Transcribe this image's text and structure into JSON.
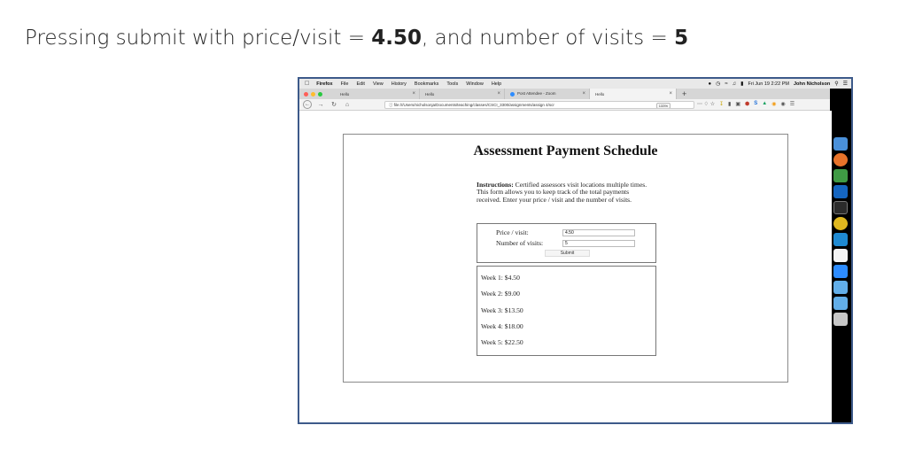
{
  "caption": {
    "lead": "Pressing submit with price/visit = ",
    "price": "4.50",
    "middle": ", and number of visits = ",
    "visits": "5"
  },
  "menubar": {
    "items": [
      "Firefox",
      "File",
      "Edit",
      "View",
      "History",
      "Bookmarks",
      "Tools",
      "Window",
      "Help"
    ],
    "datetime": "Fri Jun 19  2:22 PM",
    "user": "John Nicholson"
  },
  "tabs": [
    {
      "label": "Hello"
    },
    {
      "label": "Hello"
    },
    {
      "label": "Post Attendee - Zoom"
    },
    {
      "label": "Hello"
    }
  ],
  "toolbar": {
    "url": "file:///Users/nicholsonja/Documents/teaching/classes/CSCI_3300/assignments/assign 4/scr",
    "zoom": "133%"
  },
  "page": {
    "title": "Assessment Payment Schedule",
    "instructions_label": "Instructions:",
    "instructions_text": " Certified assessors visit locations multiple times. This form allows you to keep track of the total payments received. Enter your price / visit and the number of visits.",
    "form": {
      "price_label": "Price / visit:",
      "price_value": "4.50",
      "visits_label": "Number of visits:",
      "visits_value": "5",
      "submit_label": "Submit"
    },
    "results": [
      "Week 1: $4.50",
      "Week 2: $9.00",
      "Week 3: $13.50",
      "Week 4: $18.00",
      "Week 5: $22.50"
    ]
  },
  "colors": {
    "frame_border": "#3d5a8a",
    "close_light": "#fe5f57",
    "min_light": "#febc2e",
    "max_light": "#28c840"
  },
  "icons": {
    "dock": [
      "finder-icon",
      "firefox-icon",
      "vim-icon",
      "outlook-icon",
      "terminal-icon",
      "chrome-icon",
      "vscode-icon",
      "word-icon",
      "zoom-icon",
      "folder-icon",
      "downloads-icon",
      "trash-icon"
    ]
  }
}
